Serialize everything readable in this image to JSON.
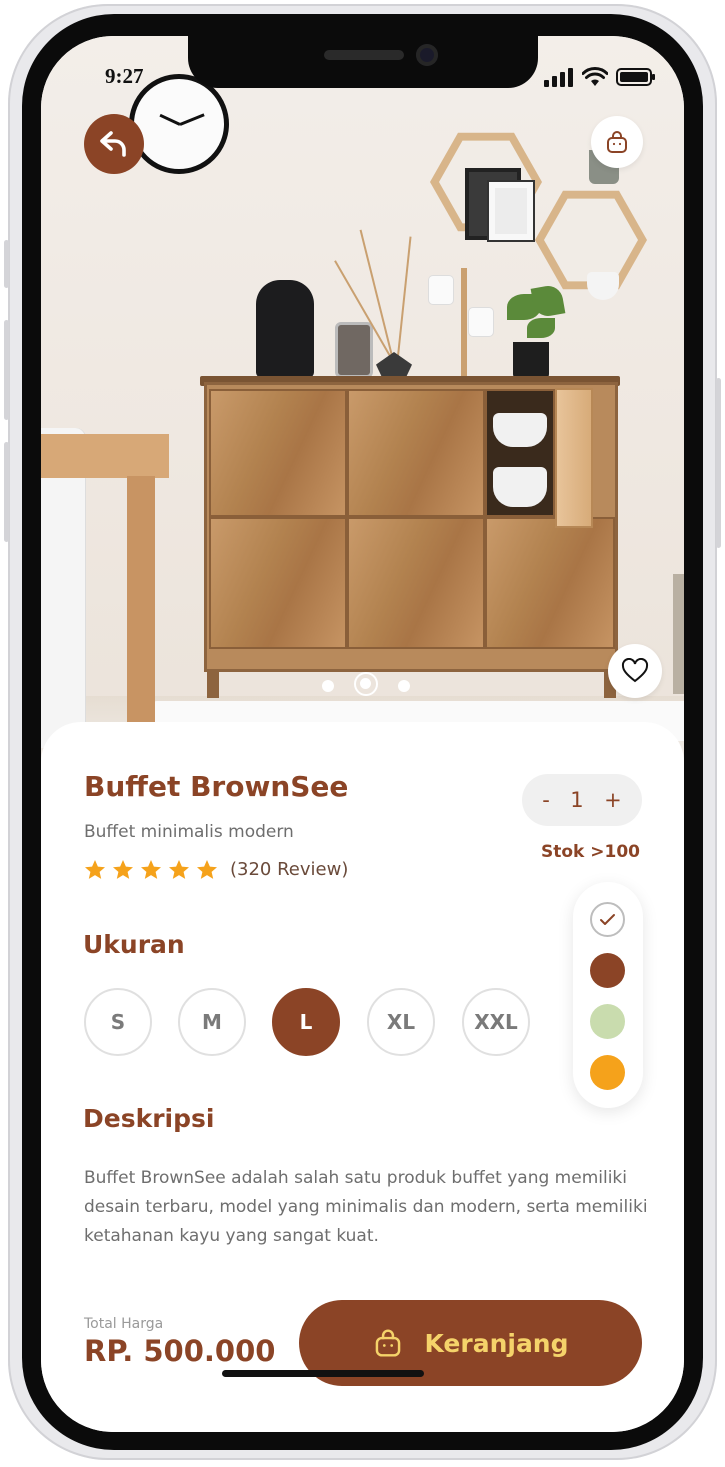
{
  "status_bar": {
    "time": "9:27"
  },
  "product": {
    "name": "Buffet BrownSee",
    "tagline": "Buffet minimalis modern",
    "rating": 5,
    "reviews": "(320 Review)",
    "quantity": {
      "minus": "-",
      "value": "1",
      "plus": "+"
    },
    "stock": "Stok >100"
  },
  "colors": {
    "options": [
      "#ffffff",
      "#8b4426",
      "#c9dcae",
      "#f5a21b"
    ],
    "selected_index": 0
  },
  "size_section": {
    "title": "Ukuran",
    "options": [
      "S",
      "M",
      "L",
      "XL",
      "XXL"
    ],
    "selected": "L"
  },
  "description_section": {
    "title": "Deskripsi",
    "text": "Buffet BrownSee adalah salah satu produk buffet yang memiliki desain terbaru, model yang minimalis dan modern, serta memiliki ketahanan kayu yang sangat kuat."
  },
  "footer": {
    "total_label": "Total Harga",
    "total_price": "RP. 500.000",
    "cart_button": "Keranjang"
  },
  "theme": {
    "primary": "#8b4426",
    "accent": "#f5d36a",
    "star": "#f5a21b"
  },
  "gallery": {
    "count": 3,
    "active_index": 1
  },
  "icons": {
    "back": "undo-arrow-icon",
    "bag": "shopping-bag-icon",
    "favorite": "heart-icon",
    "check": "check-icon",
    "star": "star-icon"
  }
}
